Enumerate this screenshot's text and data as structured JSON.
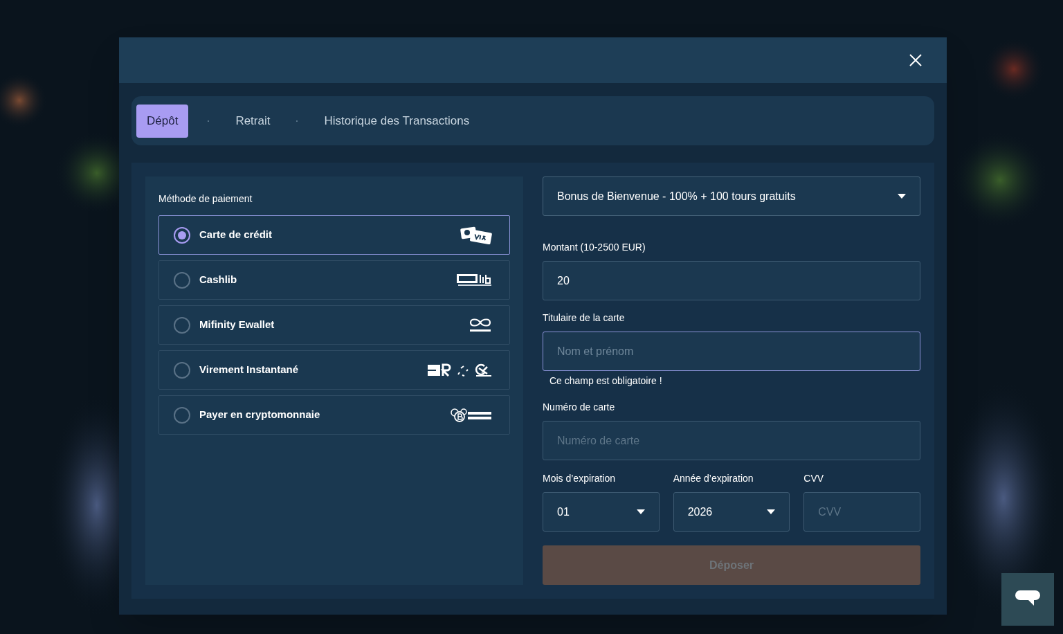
{
  "tabs": [
    {
      "label": "Dépôt",
      "selected": true
    },
    {
      "label": "Retrait",
      "selected": false
    },
    {
      "label": "Historique des Transactions",
      "selected": false
    }
  ],
  "payment": {
    "label": "Méthode de paiement",
    "methods": [
      {
        "name": "Carte de crédit",
        "selected": true
      },
      {
        "name": "Cashlib",
        "selected": false
      },
      {
        "name": "Mifinity Ewallet",
        "selected": false
      },
      {
        "name": "Virement Instantané",
        "selected": false
      },
      {
        "name": "Payer en cryptomonnaie",
        "selected": false
      }
    ]
  },
  "bonus": {
    "value": "Bonus de Bienvenue - 100% + 100 tours gratuits"
  },
  "amount": {
    "label": "Montant (10-2500 EUR)",
    "value": "20"
  },
  "holder": {
    "label": "Titulaire de la carte",
    "placeholder": "Nom et prénom",
    "focused": true,
    "error": "Ce champ est obligatoire !"
  },
  "card_number": {
    "label": "Numéro de carte",
    "placeholder": "Numéro de carte"
  },
  "month": {
    "label": "Mois d’expiration",
    "value": "01"
  },
  "year": {
    "label": "Année d’expiration",
    "value": "2026"
  },
  "cvv": {
    "label": "CVV",
    "placeholder": "CVV"
  },
  "submit": {
    "label": "Déposer",
    "disabled": true
  }
}
